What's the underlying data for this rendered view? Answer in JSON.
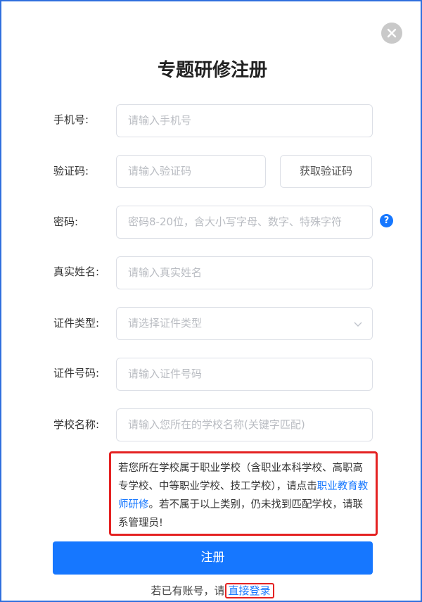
{
  "title": "专题研修注册",
  "fields": {
    "phone": {
      "label": "手机号:",
      "placeholder": "请输入手机号"
    },
    "code": {
      "label": "验证码:",
      "placeholder": "请输入验证码",
      "button": "获取验证码"
    },
    "password": {
      "label": "密码:",
      "placeholder": "密码8-20位，含大小写字母、数字、特殊字符",
      "help": "?"
    },
    "real_name": {
      "label": "真实姓名:",
      "placeholder": "请输入真实姓名"
    },
    "id_type": {
      "label": "证件类型:",
      "placeholder": "请选择证件类型"
    },
    "id_number": {
      "label": "证件号码:",
      "placeholder": "请输入证件号码"
    },
    "school": {
      "label": "学校名称:",
      "placeholder": "请输入您所在的学校名称(关键字匹配)"
    }
  },
  "notice": {
    "text_before": "若您所在学校属于职业学校（含职业本科学校、高职高专学校、中等职业学校、技工学校），请点击",
    "link": "职业教育教师研修",
    "text_after": "。若不属于以上类别，仍未找到匹配学校，请联系管理员!"
  },
  "register_button": "注册",
  "login": {
    "prefix": "若已有账号，请",
    "link": "直接登录"
  },
  "colors": {
    "accent": "#1677ff",
    "highlight": "#e42222",
    "frame": "#2f6fde"
  }
}
